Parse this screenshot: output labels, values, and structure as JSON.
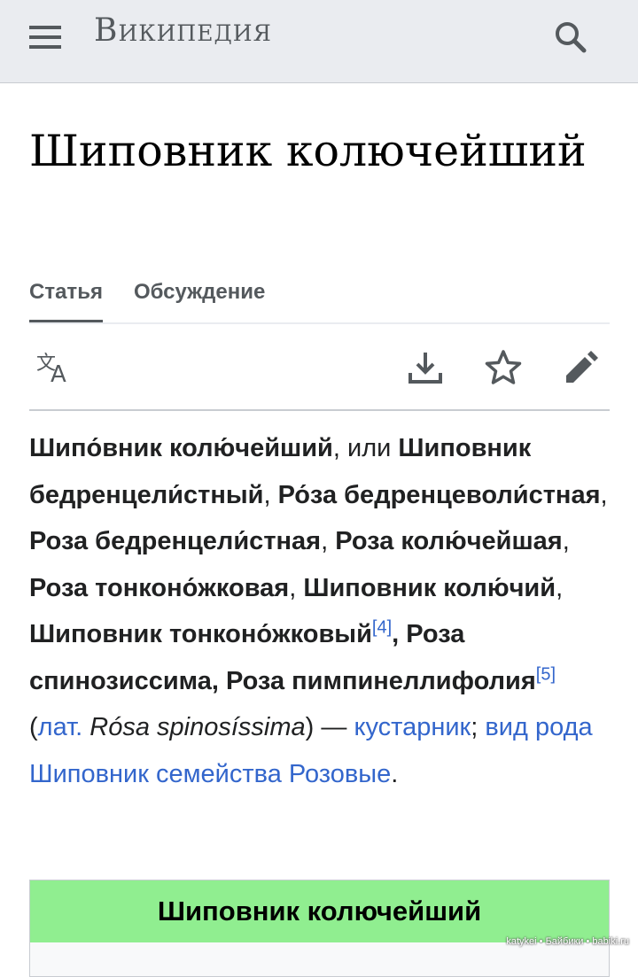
{
  "header": {
    "logo": "Википедия",
    "menu_icon": "hamburger-menu-icon",
    "search_icon": "search-icon"
  },
  "article": {
    "title": "Шиповник колючейший"
  },
  "tabs": [
    {
      "label": "Статья",
      "active": true
    },
    {
      "label": "Обсуждение",
      "active": false
    }
  ],
  "actions": {
    "language_icon": "translate-icon",
    "download_icon": "download-icon",
    "watch_icon": "star-icon",
    "edit_icon": "pencil-icon"
  },
  "content": {
    "name1": "Шипо́вник колю́чейший",
    "or": ", или ",
    "name2": "Шиповник бедренцели́стный",
    "sep1": ", ",
    "name3": "Ро́за бедренцеволи́стная",
    "sep2": ", ",
    "name4": "Роза бедренцели́стная",
    "sep3": ", ",
    "name5": "Роза колю́чейшая",
    "sep4": ", ",
    "name6": "Роза тонконо́жковая",
    "sep5": ", ",
    "name7": "Шиповник колю́чий",
    "sep6": ", ",
    "name8": "Шиповник тонконо́жковый",
    "ref4": "[4]",
    "sep7": ", ",
    "name9": "Роза спинозиссима",
    "sep8": ", ",
    "name10": "Роза пимпинеллифолия",
    "ref5": "[5]",
    "paren_open": " (",
    "lat_link": "лат.",
    "space": " ",
    "latin_name": "Rósa spinosíssima",
    "paren_close": ") — ",
    "link_shrub": "кустарник",
    "semicolon": "; ",
    "link_species": "вид",
    "space2": " ",
    "link_genus": "рода Шиповник",
    "space3": " ",
    "link_family": "семейства Розовые",
    "period": "."
  },
  "infobox": {
    "title": "Шиповник колючейший",
    "header_color": "#90ee90"
  },
  "colors": {
    "link": "#3366cc",
    "header_bg": "#eaecf0",
    "text": "#202122"
  },
  "watermark": "katykei • Байбики • babiki.ru"
}
